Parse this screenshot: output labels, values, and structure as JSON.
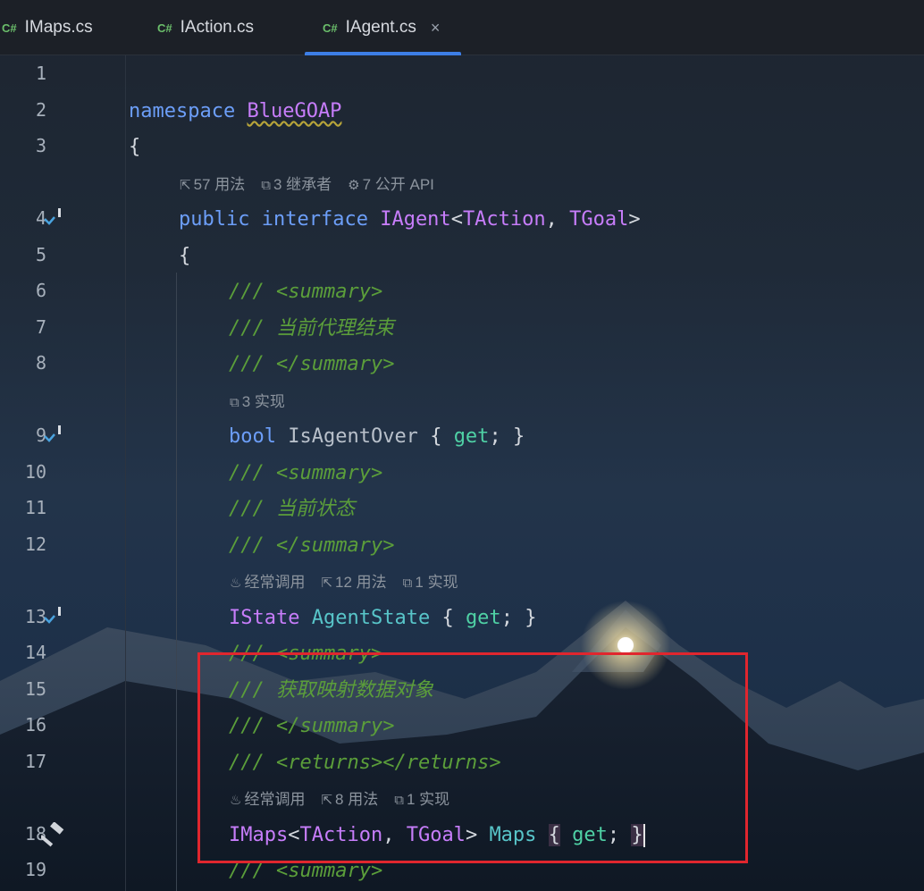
{
  "tabs": [
    {
      "icon": "C#",
      "label": "IMaps.cs"
    },
    {
      "icon": "C#",
      "label": "IAction.cs"
    },
    {
      "icon": "C#",
      "label": "IAgent.cs",
      "close": "×"
    }
  ],
  "line_numbers": [
    "1",
    "2",
    "3",
    "4",
    "5",
    "6",
    "7",
    "8",
    "9",
    "10",
    "11",
    "12",
    "13",
    "14",
    "15",
    "16",
    "17",
    "18",
    "19"
  ],
  "code": {
    "ns_kw": "namespace",
    "ns_name": "BlueGOAP",
    "open_brace": "{",
    "public_kw": "public",
    "interface_kw": "interface",
    "iface_name": "IAgent",
    "lt": "<",
    "taction": "TAction",
    "comma": ", ",
    "tgoal": "TGoal",
    "gt": ">",
    "doc_prefix": "/// ",
    "summary_open": "<summary>",
    "summary_close": "</summary>",
    "close_tag_open": "</",
    "close_tag_name": "summary",
    "close_tag_end": ">",
    "comment_1": "当前代理结束",
    "comment_2": "当前状态",
    "comment_3": "获取映射数据对象",
    "returns_open": "<returns>",
    "returns_close": "</returns>",
    "bool_kw": "bool",
    "prop_1": "IsAgentOver",
    "get_kw": "get",
    "semi": ";",
    "brace_open": "{ ",
    "brace_close": "}",
    "istate": "IState",
    "prop_2": "AgentState",
    "imaps": "IMaps",
    "prop_3": "Maps"
  },
  "hints": {
    "line4": [
      "57 用法",
      "3 继承者",
      "7 公开 API"
    ],
    "line9": [
      "3 实现"
    ],
    "line13": [
      "经常调用",
      "12 用法",
      "1 实现"
    ],
    "line18": [
      "经常调用",
      "8 用法",
      "1 实现"
    ]
  },
  "colors": {
    "keyword": "#6c9ef8",
    "type": "#c77dfa",
    "comment": "#5b9e3a",
    "accessor": "#4fd1a5",
    "highlight_box": "#e0262e",
    "active_tab": "#3d7ee6"
  }
}
